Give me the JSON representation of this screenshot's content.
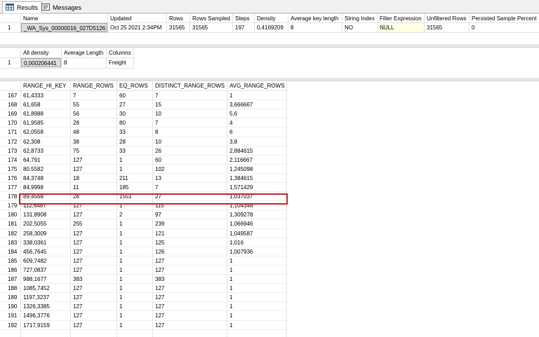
{
  "tabs": [
    {
      "label": "Results",
      "icon": "grid-icon"
    },
    {
      "label": "Messages",
      "icon": "messages-icon"
    }
  ],
  "stats_header": {
    "columns": [
      "Name",
      "Updated",
      "Rows",
      "Rows Sampled",
      "Steps",
      "Density",
      "Average key length",
      "String Index",
      "Filter Expression",
      "Unfiltered Rows",
      "Persisted Sample Percent"
    ],
    "row_num": "1",
    "row": [
      "_WA_Sys_00000016_027D5126",
      "Oct 25 2021  2:34PM",
      "31565",
      "31565",
      "197",
      "0,4169209",
      "8",
      "NO",
      "NULL",
      "31565",
      "0"
    ]
  },
  "density": {
    "columns": [
      "All density",
      "Average Length",
      "Columns"
    ],
    "row_num": "1",
    "row": [
      "0,000206441",
      "8",
      "Freight"
    ]
  },
  "histogram": {
    "columns": [
      "RANGE_HI_KEY",
      "RANGE_ROWS",
      "EQ_ROWS",
      "DISTINCT_RANGE_ROWS",
      "AVG_RANGE_ROWS"
    ],
    "highlight_row": "178",
    "rows": [
      [
        "167",
        "61,4333",
        "7",
        "60",
        "7",
        "1"
      ],
      [
        "168",
        "61,658",
        "55",
        "27",
        "15",
        "3,666667"
      ],
      [
        "169",
        "61,8988",
        "56",
        "30",
        "10",
        "5,6"
      ],
      [
        "170",
        "61,9585",
        "28",
        "80",
        "7",
        "4"
      ],
      [
        "171",
        "62,0558",
        "48",
        "33",
        "8",
        "6"
      ],
      [
        "172",
        "62,308",
        "38",
        "28",
        "10",
        "3,8"
      ],
      [
        "173",
        "62,8733",
        "75",
        "33",
        "26",
        "2,884615"
      ],
      [
        "174",
        "64,791",
        "127",
        "1",
        "60",
        "2,116667"
      ],
      [
        "175",
        "80,5582",
        "127",
        "1",
        "102",
        "1,245098"
      ],
      [
        "176",
        "84,3748",
        "18",
        "211",
        "13",
        "1,384615"
      ],
      [
        "177",
        "84,9998",
        "11",
        "185",
        "7",
        "1,571429"
      ],
      [
        "178",
        "89,4568",
        "28",
        "1551",
        "27",
        "1,037037"
      ],
      [
        "179",
        "112,6487",
        "127",
        "1",
        "115",
        "1,104348"
      ],
      [
        "180",
        "131,8908",
        "127",
        "2",
        "97",
        "1,309278"
      ],
      [
        "181",
        "202,5055",
        "255",
        "1",
        "239",
        "1,066946"
      ],
      [
        "182",
        "258,3009",
        "127",
        "1",
        "121",
        "1,049587"
      ],
      [
        "183",
        "338,0361",
        "127",
        "1",
        "125",
        "1,016"
      ],
      [
        "184",
        "456,7645",
        "127",
        "1",
        "126",
        "1,007936"
      ],
      [
        "185",
        "609,7482",
        "127",
        "1",
        "127",
        "1"
      ],
      [
        "186",
        "727,0837",
        "127",
        "1",
        "127",
        "1"
      ],
      [
        "187",
        "988,1677",
        "383",
        "1",
        "383",
        "1"
      ],
      [
        "188",
        "1085,7452",
        "127",
        "1",
        "127",
        "1"
      ],
      [
        "189",
        "1197,3237",
        "127",
        "1",
        "127",
        "1"
      ],
      [
        "190",
        "1326,3385",
        "127",
        "1",
        "127",
        "1"
      ],
      [
        "191",
        "1496,3776",
        "127",
        "1",
        "127",
        "1"
      ],
      [
        "192",
        "1717,9159",
        "127",
        "1",
        "127",
        "1"
      ]
    ]
  }
}
